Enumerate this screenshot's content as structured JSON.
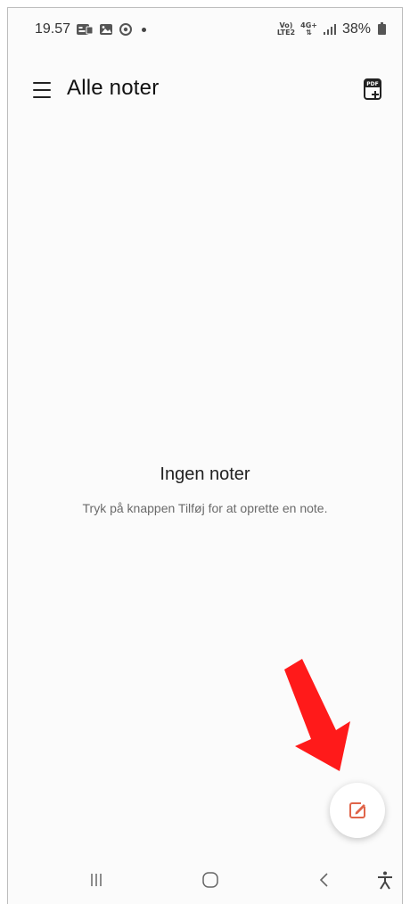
{
  "status_bar": {
    "time": "19.57",
    "network_label_top": "Vo)",
    "network_label_bottom": "LTE2",
    "network_type": "4G+",
    "battery": "38%"
  },
  "app_bar": {
    "title": "Alle noter",
    "menu_icon": "hamburger-menu-icon",
    "pdf_icon": "pdf-add-icon",
    "pdf_badge": "PDF"
  },
  "empty_state": {
    "title": "Ingen noter",
    "hint": "Tryk på knappen Tilføj for at oprette en note."
  },
  "fab": {
    "icon": "compose-note-icon",
    "accent_color": "#e0654a"
  },
  "annotation": {
    "arrow_color": "#ff1a1a"
  },
  "nav_bar": {
    "items": [
      "recents-icon",
      "home-icon",
      "back-icon",
      "accessibility-icon"
    ]
  }
}
